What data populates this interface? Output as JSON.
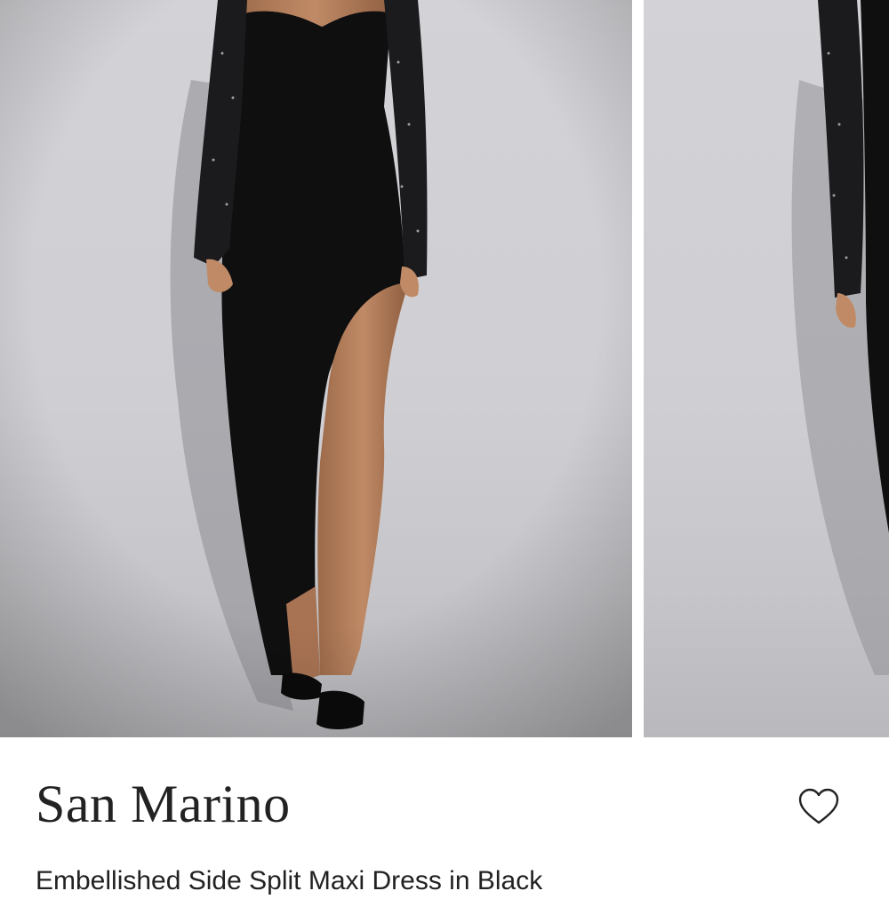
{
  "product": {
    "brand": "San Marino",
    "name": "Embellished Side Split Maxi Dress in Black",
    "color": "#222222"
  },
  "gallery": {
    "images": [
      {
        "icon": "product-photo-front"
      },
      {
        "icon": "product-photo-side"
      }
    ]
  },
  "actions": {
    "wishlist_icon": "heart-outline-icon"
  }
}
